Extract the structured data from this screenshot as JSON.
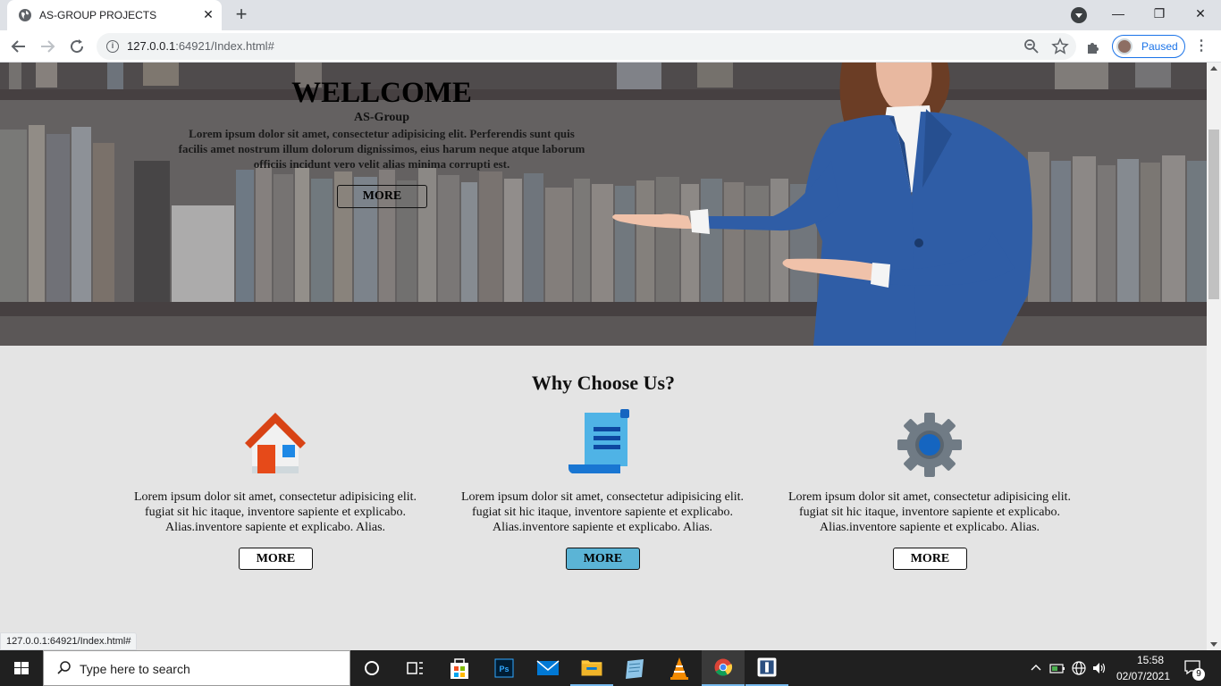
{
  "browser": {
    "tab_title": "AS-GROUP PROJECTS",
    "tab_close": "✕",
    "new_tab": "+",
    "url_host": "127.0.0.1",
    "url_rest": ":64921/Index.html#",
    "profile_label": "Paused",
    "status_url": "127.0.0.1:64921/Index.html#",
    "window_buttons": {
      "minimize": "—",
      "restore": "❐",
      "close": "✕"
    }
  },
  "hero": {
    "title": "WELLCOME",
    "subtitle": "AS-Group",
    "text": "Lorem ipsum dolor sit amet, consectetur adipisicing elit. Perferendis sunt quis facilis amet nostrum illum dolorum dignissimos, eius harum neque atque laborum officiis incidunt vero velit alias minima corrupti est.",
    "button": "MORE"
  },
  "why": {
    "title": "Why Choose Us?",
    "features": [
      {
        "icon": "house-icon",
        "text": "Lorem ipsum dolor sit amet, consectetur adipisicing elit. fugiat sit hic itaque, inventore sapiente et explicabo. Alias.inventore sapiente et explicabo. Alias.",
        "button": "MORE"
      },
      {
        "icon": "document-scroll-icon",
        "text": "Lorem ipsum dolor sit amet, consectetur adipisicing elit. fugiat sit hic itaque, inventore sapiente et explicabo. Alias.inventore sapiente et explicabo. Alias.",
        "button": "MORE"
      },
      {
        "icon": "gear-icon",
        "text": "Lorem ipsum dolor sit amet, consectetur adipisicing elit. fugiat sit hic itaque, inventore sapiente et explicabo. Alias.inventore sapiente et explicabo. Alias.",
        "button": "MORE"
      }
    ]
  },
  "taskbar": {
    "search_placeholder": "Type here to search",
    "time": "15:58",
    "date": "02/07/2021",
    "notification_count": "9",
    "accent": "#76b9ed"
  },
  "colors": {
    "active_button": "#5bb4d6",
    "page_background": "#e4e4e4",
    "profile_accent": "#1a73e8"
  }
}
